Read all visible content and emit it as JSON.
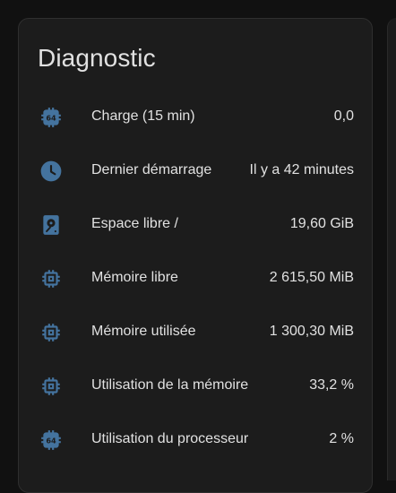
{
  "card": {
    "title": "Diagnostic",
    "icon_color": "#44739e",
    "rows": [
      {
        "icon": "cpu-64-bit-icon",
        "label": "Charge (15 min)",
        "value": "0,0"
      },
      {
        "icon": "clock-icon",
        "label": "Dernier démarrage",
        "value": "Il y a 42 minutes"
      },
      {
        "icon": "harddisk-icon",
        "label": "Espace libre /",
        "value": "19,60 GiB"
      },
      {
        "icon": "memory-icon",
        "label": "Mémoire libre",
        "value": "2 615,50 MiB"
      },
      {
        "icon": "memory-icon",
        "label": "Mémoire utilisée",
        "value": "1 300,30 MiB"
      },
      {
        "icon": "memory-icon",
        "label": "Utilisation de la mémoire",
        "value": "33,2 %"
      },
      {
        "icon": "cpu-64-bit-icon",
        "label": "Utilisation du processeur",
        "value": "2 %"
      }
    ]
  }
}
